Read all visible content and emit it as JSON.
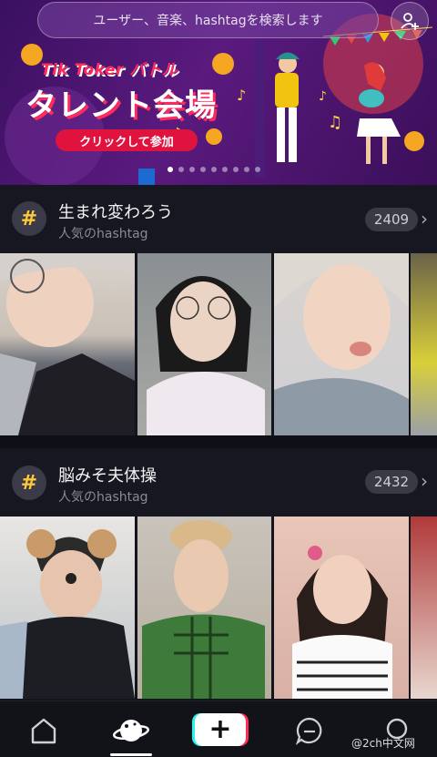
{
  "search": {
    "placeholder": "ユーザー、音楽、hashtagを検索します"
  },
  "banner": {
    "brand": "Tik Toker バトル",
    "headline": "タレント会場",
    "cta": "クリックして参加",
    "pager_count": 9,
    "pager_active": 0
  },
  "sections": [
    {
      "title": "生まれ変わろう",
      "subtitle": "人気のhashtag",
      "count": "2409"
    },
    {
      "title": "脳みそ夫体操",
      "subtitle": "人気のhashtag",
      "count": "2432"
    }
  ],
  "watermark": "@2ch中文网",
  "colors": {
    "accent_red": "#fe2c55",
    "accent_cyan": "#25f4ee",
    "hashtag_yellow": "#ffc933"
  },
  "icons": {
    "add_user": "add-user-icon",
    "home": "home-icon",
    "discover": "planet-icon",
    "create": "plus-icon",
    "inbox": "message-icon",
    "profile": "profile-icon"
  }
}
